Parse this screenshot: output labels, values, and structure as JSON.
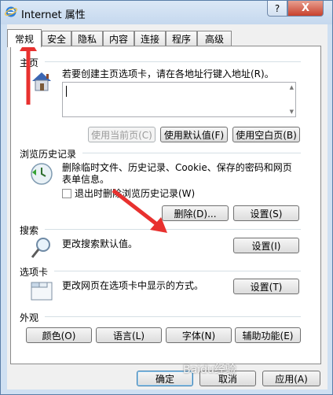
{
  "window": {
    "title": "Internet 属性",
    "help_label": "?",
    "close_label": "X"
  },
  "tabs": [
    {
      "label": "常规",
      "active": true
    },
    {
      "label": "安全"
    },
    {
      "label": "隐私"
    },
    {
      "label": "内容"
    },
    {
      "label": "连接"
    },
    {
      "label": "程序"
    },
    {
      "label": "高级"
    }
  ],
  "homepage": {
    "section": "主页",
    "description": "若要创建主页选项卡，请在各地址行键入地址(R)。",
    "value": "",
    "use_current": "使用当前页(C)",
    "use_default": "使用默认值(F)",
    "use_blank": "使用空白页(B)"
  },
  "history": {
    "section": "浏览历史记录",
    "description_line1": "删除临时文件、历史记录、Cookie、保存的密码和网页",
    "description_line2": "表单信息。",
    "checkbox_label": "退出时删除浏览历史记录(W)",
    "checked": false,
    "delete_button": "删除(D)...",
    "settings_button": "设置(S)"
  },
  "search": {
    "section": "搜索",
    "description": "更改搜索默认值。",
    "settings_button": "设置(I)"
  },
  "tabs_section": {
    "section": "选项卡",
    "description": "更改网页在选项卡中显示的方式。",
    "settings_button": "设置(T)"
  },
  "appearance": {
    "section": "外观",
    "colors": "颜色(O)",
    "languages": "语言(L)",
    "fonts": "字体(N)",
    "accessibility": "辅助功能(E)"
  },
  "footer": {
    "ok": "确定",
    "cancel": "取消",
    "apply": "应用(A)"
  },
  "watermark": "Baidu经验",
  "colors": {
    "annotation_arrow": "#e8312f",
    "title_bg": "#cfe0f2",
    "close_bg": "#c8412c"
  }
}
